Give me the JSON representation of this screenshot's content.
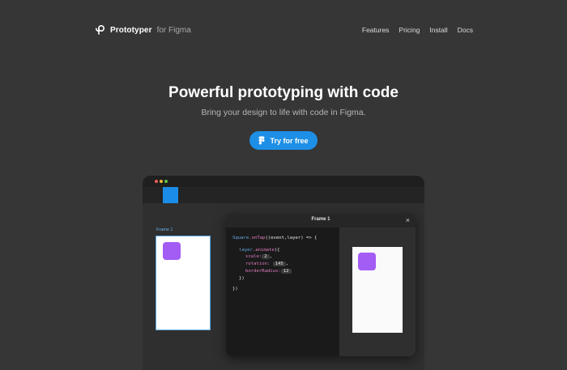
{
  "brand": {
    "name": "Prototyper",
    "suffix": "for Figma"
  },
  "nav": {
    "links": [
      "Features",
      "Pricing",
      "Install",
      "Docs"
    ]
  },
  "hero": {
    "title": "Powerful prototyping with code",
    "subtitle": "Bring your design to life with code in Figma.",
    "cta_label": "Try for free"
  },
  "app_window": {
    "frame_label": "Frame 1",
    "dialog_title": "Frame 1",
    "close_glyph": "×",
    "code": {
      "line1_object": "Square",
      "line1_method": ".onTap",
      "line1_args": "((event,layer) => {",
      "line2_object": "layer",
      "line2_method": ".animate",
      "line2_open": "({",
      "scale_key": "scale:",
      "scale_value": "2",
      "rotation_key": "rotation:",
      "rotation_value": "145",
      "radius_key": "borderRadius:",
      "radius_value": "12",
      "close_inner": "})",
      "close_outer": "})"
    }
  },
  "colors": {
    "accent": "#1e8fe6",
    "purple": "#a35cf4",
    "background": "#363636"
  },
  "icons": {
    "brand": "prototyper-logo-icon",
    "cta": "figma-icon",
    "close": "close-icon"
  }
}
